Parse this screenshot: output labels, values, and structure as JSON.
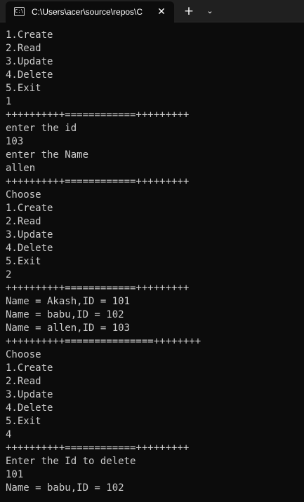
{
  "window": {
    "tab_title": "C:\\Users\\acer\\source\\repos\\C",
    "tab_icon_glyph": "C:\\",
    "close_glyph": "✕",
    "new_tab_glyph": "+",
    "dropdown_glyph": "⌄",
    "icons": {
      "tab": "terminal-icon",
      "close": "close-icon",
      "new_tab": "plus-icon",
      "dropdown": "chevron-down-icon"
    }
  },
  "colors": {
    "background": "#0c0c0c",
    "titlebar": "#202020",
    "text": "#cccccc"
  },
  "console": {
    "lines": [
      "1.Create",
      "2.Read",
      "3.Update",
      "4.Delete",
      "5.Exit",
      "1",
      "++++++++++============+++++++++",
      "enter the id",
      "103",
      "enter the Name",
      "allen",
      "++++++++++============+++++++++",
      "Choose",
      "1.Create",
      "2.Read",
      "3.Update",
      "4.Delete",
      "5.Exit",
      "2",
      "++++++++++============+++++++++",
      "Name = Akash,ID = 101",
      "Name = babu,ID = 102",
      "Name = allen,ID = 103",
      "++++++++++===============++++++++",
      "Choose",
      "1.Create",
      "2.Read",
      "3.Update",
      "4.Delete",
      "5.Exit",
      "4",
      "++++++++++============+++++++++",
      "Enter the Id to delete",
      "101",
      "Name = babu,ID = 102"
    ]
  }
}
